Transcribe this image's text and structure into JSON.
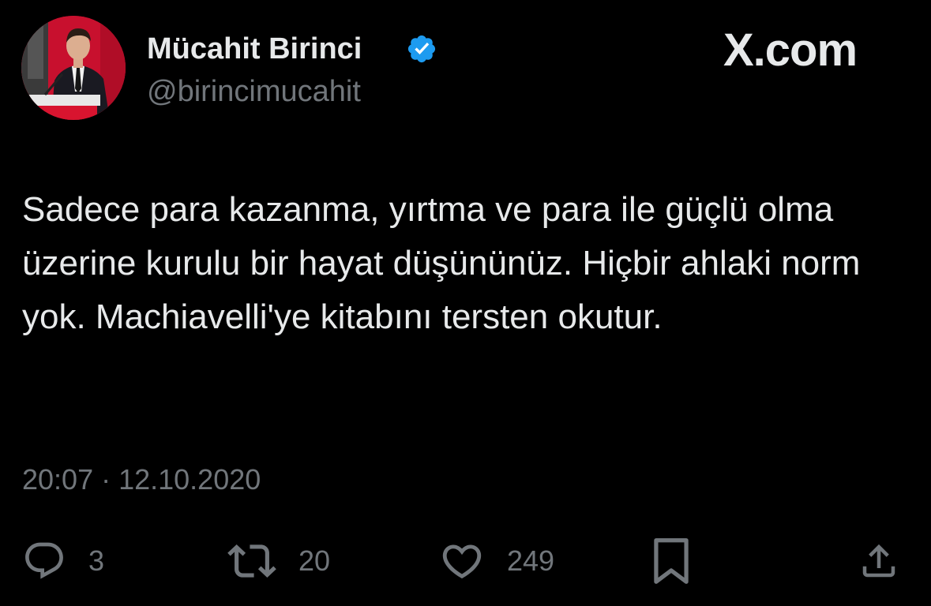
{
  "author": {
    "display_name": "Mücahit Birinci",
    "handle": "@birincimucahit",
    "avatar": "profile-photo",
    "verified_icon": "verified-badge-icon",
    "verified_color": "#1d9bf0"
  },
  "brand": {
    "label": "X.com"
  },
  "tweet": {
    "text": "Sadece para kazanma, yırtma ve para ile güçlü olma üzerine kurulu bir hayat düşününüz. Hiçbir ahlaki norm yok. Machiavelli'ye kitabını tersten okutur.",
    "meta": "20:07 · 12.10.2020"
  },
  "actions": {
    "reply": {
      "icon": "reply-icon",
      "count": "3"
    },
    "repost": {
      "icon": "repost-icon",
      "count": "20"
    },
    "like": {
      "icon": "heart-icon",
      "count": "249"
    },
    "bookmark": {
      "icon": "bookmark-icon"
    },
    "share": {
      "icon": "share-icon"
    }
  },
  "colors": {
    "background": "#000000",
    "text_primary": "#e7e9ea",
    "text_secondary": "#71767b",
    "accent": "#1d9bf0"
  }
}
